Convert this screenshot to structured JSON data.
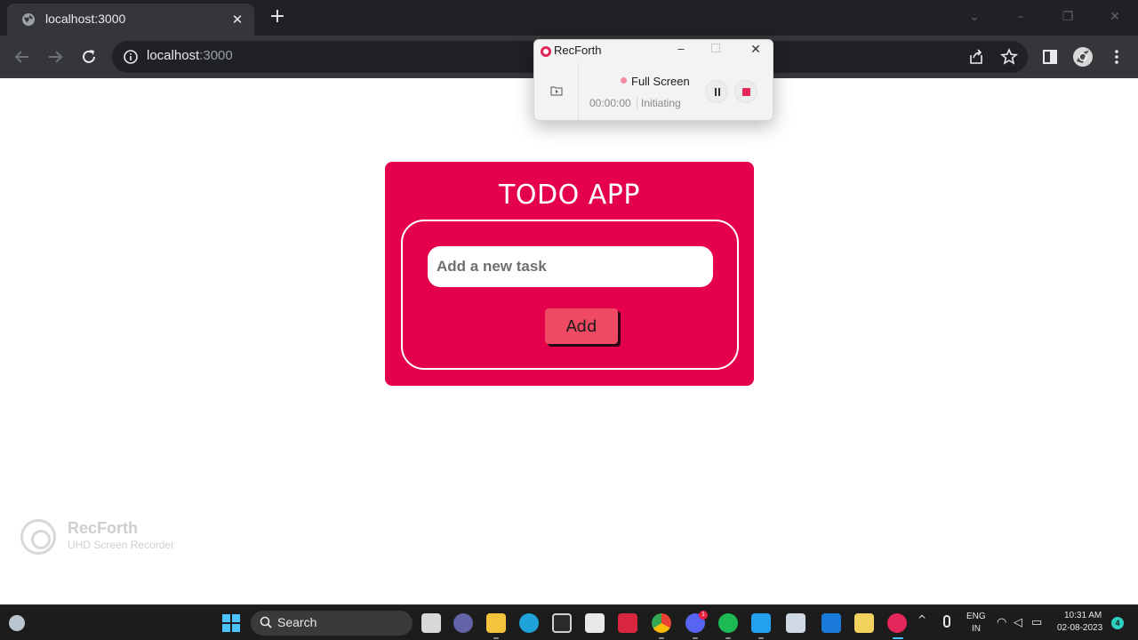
{
  "browser": {
    "tab_title": "localhost:3000",
    "tab_close_glyph": "✕",
    "new_tab_glyph": "+",
    "url_host": "localhost",
    "url_port": ":3000",
    "window_controls": [
      "–",
      "❐",
      "✕"
    ]
  },
  "recorder": {
    "title": "RecForth",
    "minimize_glyph": "–",
    "close_glyph": "✕",
    "mode": "Full Screen",
    "time": "00:00:00",
    "status": "Initiating",
    "accent_color": "#e5265a"
  },
  "todo": {
    "title": "TODO APP",
    "input_placeholder": "Add a new task",
    "add_label": "Add",
    "card_color": "#e4004b",
    "button_color": "#ef4a63"
  },
  "watermark": {
    "name": "RecForth",
    "subtitle": "UHD Screen Recorder"
  },
  "taskbar": {
    "search_label": "Search",
    "apps": [
      "file-explorer-white",
      "teams",
      "file-explorer",
      "edge",
      "terminal",
      "store",
      "wps-office",
      "chrome",
      "discord",
      "spotify",
      "vscode",
      "snipping-tool",
      "mail",
      "sticky-files",
      "recforth"
    ],
    "discord_badge": "1",
    "tray_chevron": "^",
    "lang_line1": "ENG",
    "lang_line2": "IN",
    "clock_time": "10:31 AM",
    "clock_date": "02-08-2023",
    "notification_count": "4"
  }
}
